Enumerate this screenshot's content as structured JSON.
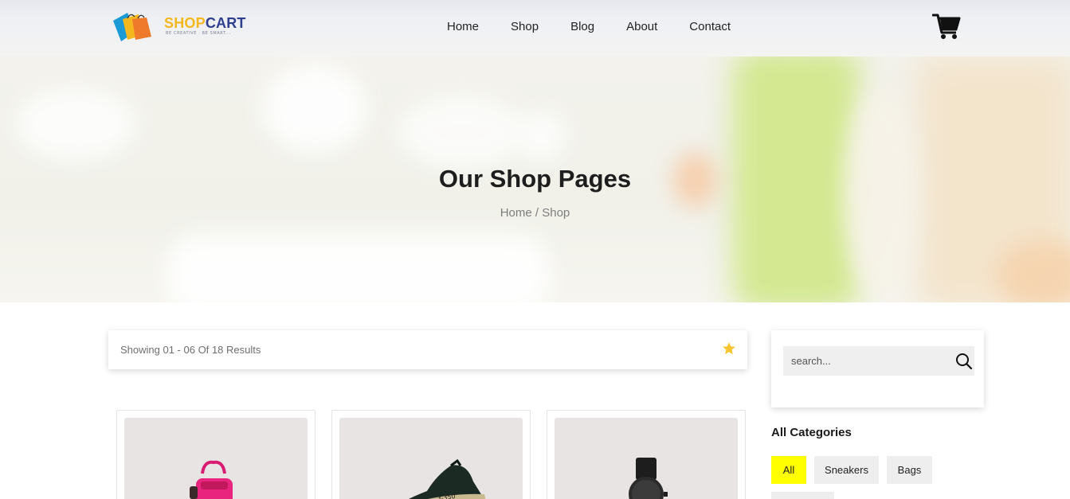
{
  "brand": {
    "name_part1": "SHOP",
    "name_part2": "CART",
    "tagline": "BE CREATIVE · BE SMART..."
  },
  "nav": {
    "items": [
      "Home",
      "Shop",
      "Blog",
      "About",
      "Contact"
    ]
  },
  "hero": {
    "title": "Our Shop Pages",
    "breadcrumb": "Home / Shop"
  },
  "results": {
    "text": "Showing 01 - 06 Of 18 Results"
  },
  "search": {
    "placeholder": "search...",
    "value": ""
  },
  "categories": {
    "title": "All Categories",
    "items": [
      "All",
      "Sneakers",
      "Bags"
    ],
    "active": "All"
  },
  "products": [
    {
      "image": "pink-backpack"
    },
    {
      "image": "black-sneaker"
    },
    {
      "image": "black-watch"
    }
  ],
  "colors": {
    "accent": "#ffff00",
    "star": "#f6c531",
    "logo_yellow": "#f4b71d",
    "logo_blue": "#2f3f8f"
  },
  "icons": {
    "cart": "cart-icon",
    "star": "star-icon",
    "search": "search-icon"
  }
}
